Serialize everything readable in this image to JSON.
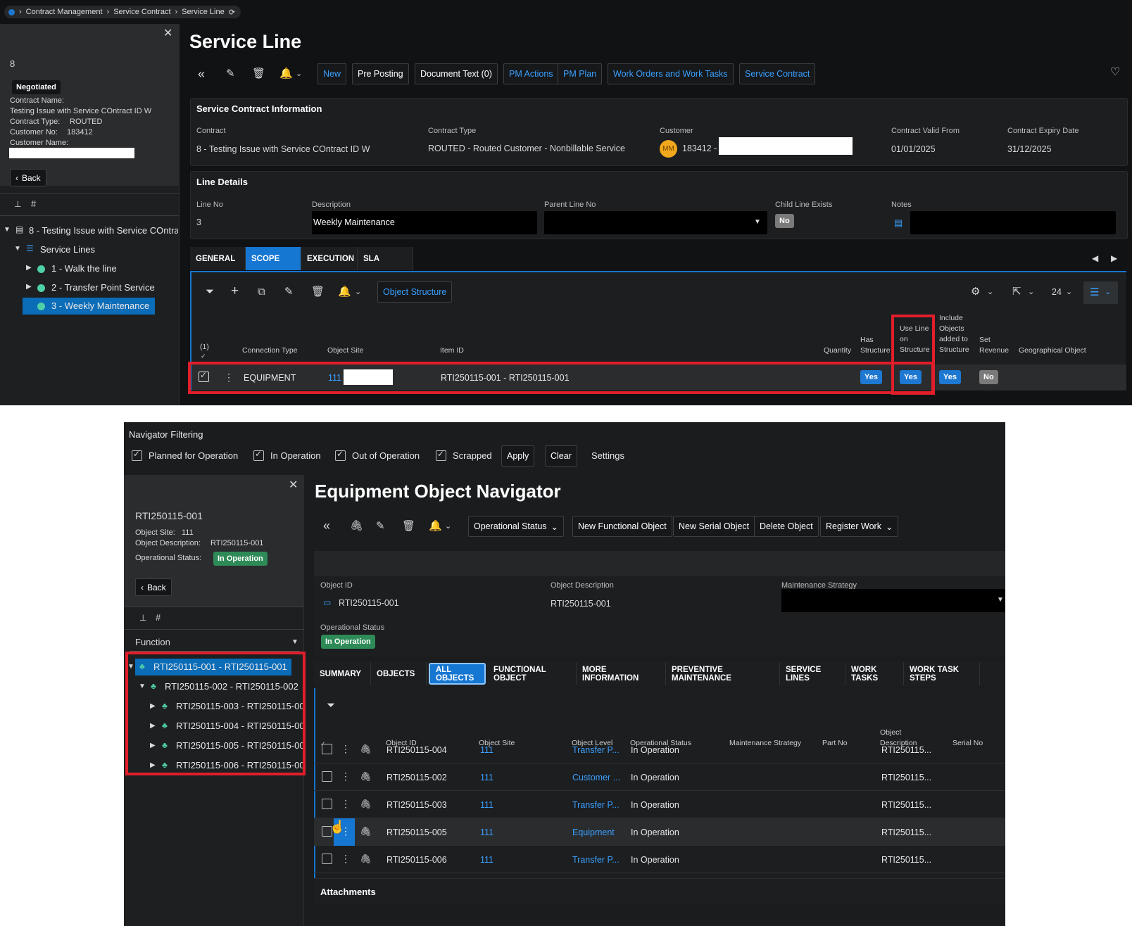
{
  "top": {
    "breadcrumb": [
      "Contract Management",
      "Service Contract",
      "Service Line"
    ],
    "sidebar": {
      "id": "8",
      "status": "Negotiated",
      "contract_name_label": "Contract Name:",
      "contract_name_value": "Testing Issue with Service COntract ID W",
      "contract_type_label": "Contract Type:",
      "contract_type_value": "ROUTED",
      "customer_no_label": "Customer No:",
      "customer_no_value": "183412",
      "customer_name_label": "Customer Name:",
      "back": "Back",
      "tree_root": "8 - Testing Issue with Service COntra",
      "tree_group": "Service Lines",
      "tree_items": [
        "1 - Walk the line",
        "2 - Transfer Point Service",
        "3 - Weekly Maintenance"
      ]
    },
    "title": "Service Line",
    "toolbar": [
      "New",
      "Pre Posting",
      "Document Text (0)",
      "PM Actions",
      "PM Plan",
      "Work Orders and Work Tasks",
      "Service Contract"
    ],
    "info": {
      "header": "Service Contract Information",
      "contract_label": "Contract",
      "contract_value": "8 - Testing Issue with Service COntract ID W",
      "type_label": "Contract Type",
      "type_value": "ROUTED - Routed Customer - Nonbillable Service",
      "customer_label": "Customer",
      "customer_avatar": "MM",
      "customer_value": "183412 -",
      "valid_from_label": "Contract Valid From",
      "valid_from_value": "01/01/2025",
      "expiry_label": "Contract Expiry Date",
      "expiry_value": "31/12/2025"
    },
    "line": {
      "header": "Line Details",
      "line_no_label": "Line No",
      "line_no_value": "3",
      "desc_label": "Description",
      "desc_value": "Weekly Maintenance",
      "parent_label": "Parent Line No",
      "child_label": "Child Line Exists",
      "child_value": "No",
      "notes_label": "Notes"
    },
    "tabs": [
      "GENERAL",
      "SCOPE",
      "EXECUTION",
      "SLA"
    ],
    "grid": {
      "object_structure": "Object Structure",
      "page_size": "24",
      "sel_count": "(1)",
      "headers": {
        "connection_type": "Connection Type",
        "object_site": "Object Site",
        "item_id": "Item ID",
        "quantity": "Quantity",
        "has_structure": "Has Structure",
        "use_line": "Use Line on Structure",
        "include_objects": "Include Objects added to Structure",
        "set_revenue": "Set Revenue",
        "geo": "Geographical Object"
      },
      "row": {
        "connection_type": "EQUIPMENT",
        "object_site": "111",
        "item_id": "RTI250115-001 - RTI250115-001",
        "has_structure": "Yes",
        "use_line": "Yes",
        "include_objects": "Yes",
        "set_revenue": "No"
      }
    }
  },
  "bottom": {
    "filter_title": "Navigator Filtering",
    "filters": [
      "Planned for Operation",
      "In Operation",
      "Out of Operation",
      "Scrapped"
    ],
    "apply": "Apply",
    "clear": "Clear",
    "settings": "Settings",
    "sidebar": {
      "id": "RTI250115-001",
      "site_label": "Object Site:",
      "site_value": "111",
      "desc_label": "Object Description:",
      "desc_value": "RTI250115-001",
      "status_label": "Operational Status:",
      "status_value": "In Operation",
      "back": "Back",
      "function_label": "Function",
      "tree": [
        "RTI250115-001 - RTI250115-001",
        "RTI250115-002 - RTI250115-002",
        "RTI250115-003 - RTI250115-00",
        "RTI250115-004 - RTI250115-00",
        "RTI250115-005 - RTI250115-00",
        "RTI250115-006 - RTI250115-00"
      ]
    },
    "title": "Equipment Object Navigator",
    "toolbar": [
      "Operational Status",
      "New Functional Object",
      "New Serial Object",
      "Delete Object",
      "Register Work"
    ],
    "detail": {
      "object_id_label": "Object ID",
      "object_id_value": "RTI250115-001",
      "desc_label": "Object Description",
      "desc_value": "RTI250115-001",
      "strategy_label": "Maintenance Strategy",
      "status_label": "Operational Status",
      "status_value": "In Operation"
    },
    "tabs": [
      "SUMMARY",
      "OBJECTS",
      "ALL OBJECTS",
      "FUNCTIONAL OBJECT",
      "MORE INFORMATION",
      "PREVENTIVE MAINTENANCE",
      "SERVICE LINES",
      "WORK TASKS",
      "WORK TASK STEPS"
    ],
    "headers": [
      "Object ID",
      "Object Site",
      "Object Level",
      "Operational Status",
      "Maintenance Strategy",
      "Part No",
      "Object Description",
      "Serial No"
    ],
    "rows": [
      {
        "id": "RTI250115-004",
        "site": "111",
        "level": "Transfer P...",
        "status": "In Operation",
        "desc": "RTI250115..."
      },
      {
        "id": "RTI250115-002",
        "site": "111",
        "level": "Customer ...",
        "status": "In Operation",
        "desc": "RTI250115..."
      },
      {
        "id": "RTI250115-003",
        "site": "111",
        "level": "Transfer P...",
        "status": "In Operation",
        "desc": "RTI250115..."
      },
      {
        "id": "RTI250115-005",
        "site": "111",
        "level": "Equipment",
        "status": "In Operation",
        "desc": "RTI250115..."
      },
      {
        "id": "RTI250115-006",
        "site": "111",
        "level": "Transfer P...",
        "status": "In Operation",
        "desc": "RTI250115..."
      }
    ],
    "attachments": "Attachments"
  }
}
